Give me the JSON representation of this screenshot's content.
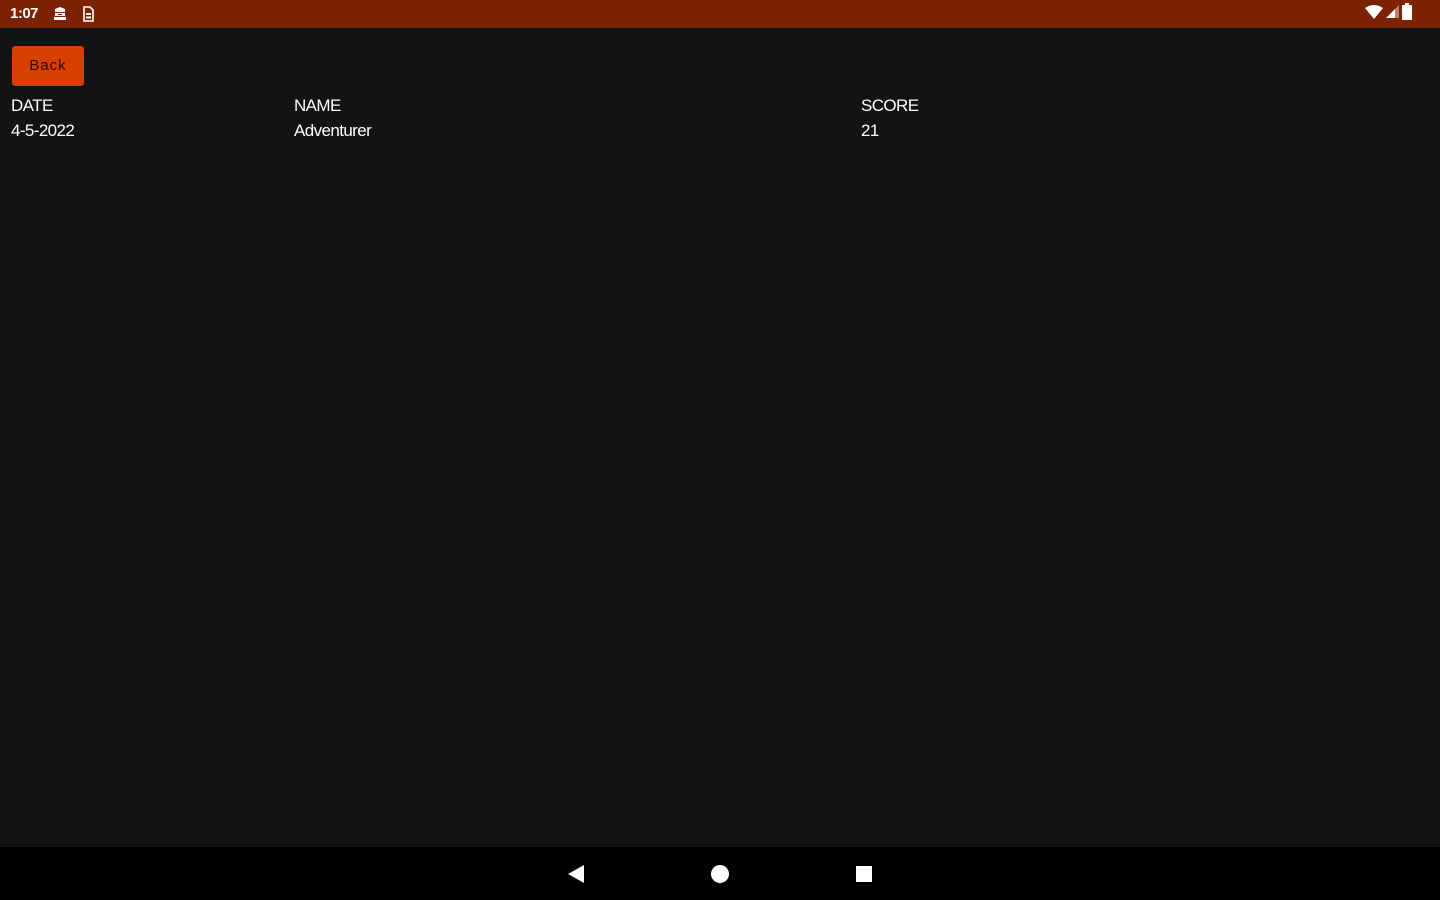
{
  "status_bar": {
    "time": "1:07",
    "background_color": "#7b2200",
    "icons": [
      "notification-app-icon",
      "sim-card-icon",
      "wifi-icon",
      "cellular-signal-icon",
      "battery-icon"
    ]
  },
  "toolbar": {
    "back_label": "Back",
    "back_color": "#d84000"
  },
  "scores_table": {
    "headers": {
      "date": "DATE",
      "name": "NAME",
      "score": "SCORE"
    },
    "rows": [
      {
        "date": "4-5-2022",
        "name": "Adventurer",
        "score": "21"
      }
    ]
  },
  "nav_bar": {
    "buttons": [
      "back-icon",
      "home-icon",
      "recents-icon"
    ]
  }
}
